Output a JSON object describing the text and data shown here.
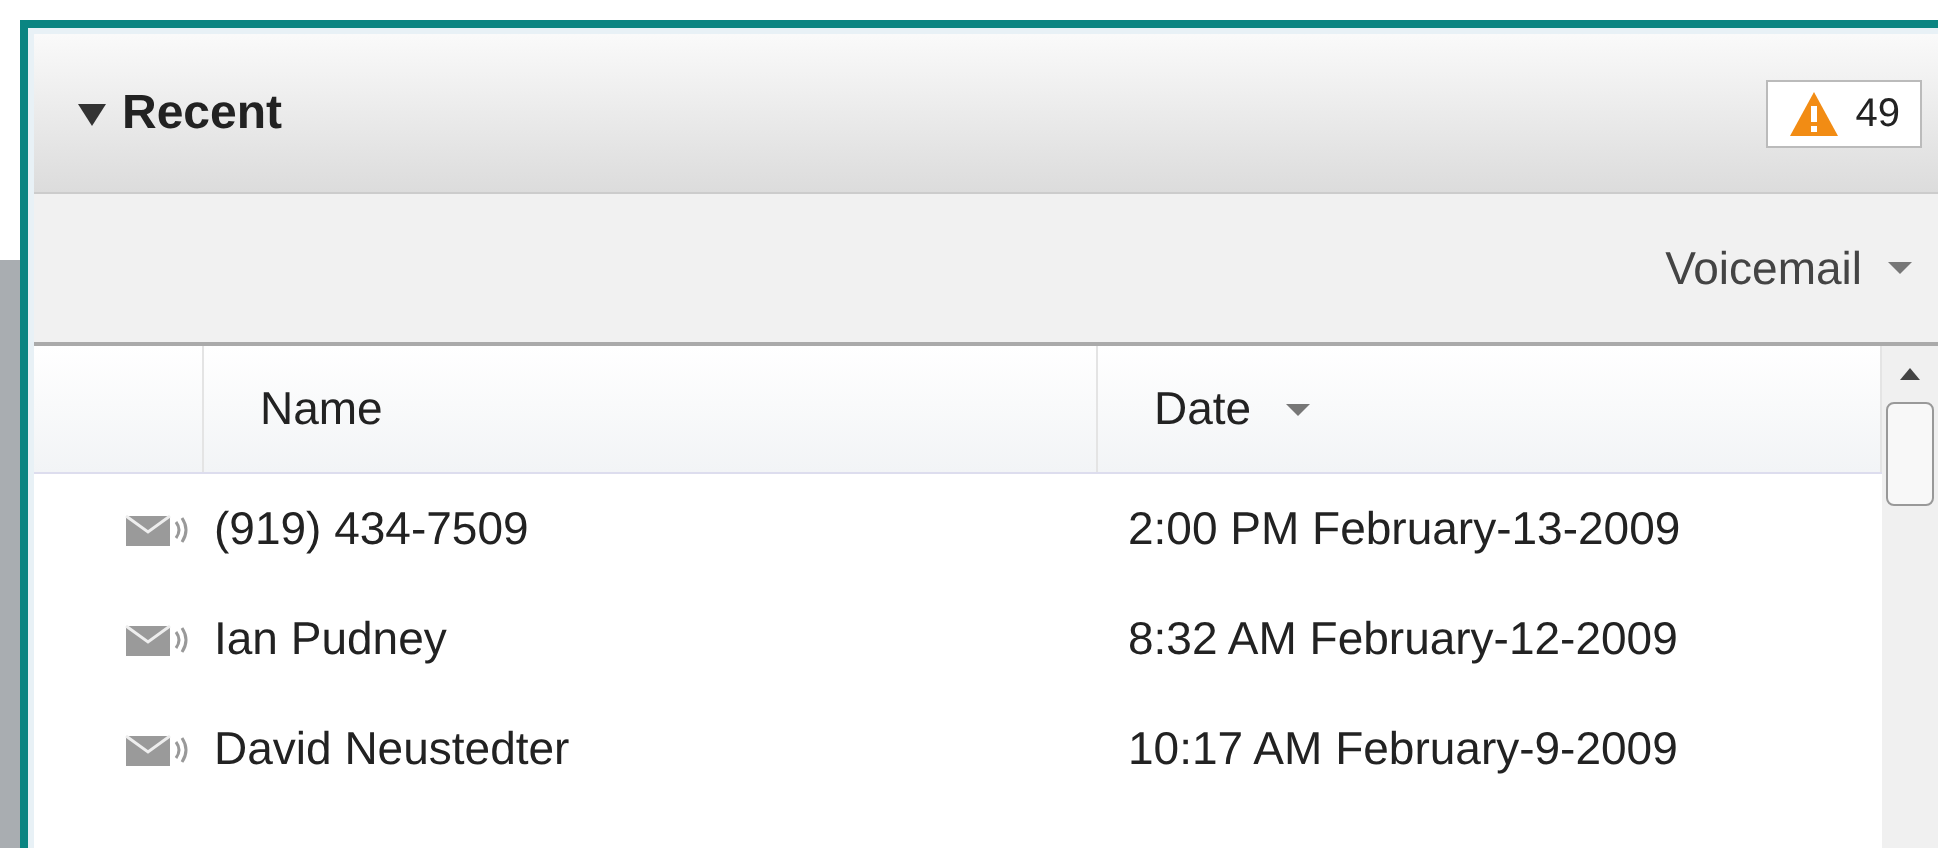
{
  "panel": {
    "title": "Recent",
    "expanded": true,
    "alert_count": "49"
  },
  "toolbar": {
    "filter": "Voicemail"
  },
  "table": {
    "columns": [
      {
        "label": "Name",
        "sorted": false
      },
      {
        "label": "Date",
        "sorted": true
      }
    ],
    "rows": [
      {
        "name": "(919) 434-7509",
        "date": "2:00 PM February-13-2009"
      },
      {
        "name": "Ian Pudney",
        "date": "8:32 AM February-12-2009"
      },
      {
        "name": "David Neustedter",
        "date": "10:17 AM February-9-2009"
      }
    ]
  }
}
